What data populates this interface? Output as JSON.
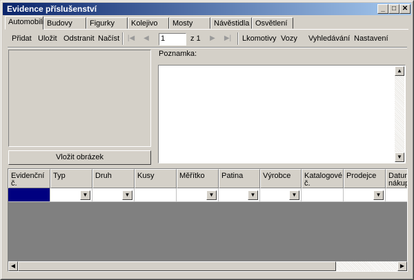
{
  "window": {
    "title": "Evidence příslušenství"
  },
  "tabs": [
    "Automobili",
    "Budovy",
    "Figurky",
    "Kolejivo",
    "Mosty",
    "Návěstidla",
    "Osvětlení"
  ],
  "toolbar": {
    "add": "Přidat",
    "save": "Uložit",
    "remove": "Odstranit",
    "load": "Načíst",
    "page_value": "1",
    "page_of": "z 1",
    "locomotives": "Lkomotivy",
    "wagons": "Vozy",
    "search": "Vyhledávání",
    "settings": "Nastavení"
  },
  "image_button": "Vložit obrázek",
  "note_label": "Poznamka:",
  "note_value": "",
  "grid": {
    "columns": [
      {
        "label": "Evidenční č.",
        "has_dropdown": false
      },
      {
        "label": "Typ",
        "has_dropdown": true
      },
      {
        "label": "Druh",
        "has_dropdown": true
      },
      {
        "label": "Kusy",
        "has_dropdown": false
      },
      {
        "label": "Měřítko",
        "has_dropdown": true
      },
      {
        "label": "Patina",
        "has_dropdown": true
      },
      {
        "label": "Výrobce",
        "has_dropdown": true
      },
      {
        "label": "Katalogové č.",
        "has_dropdown": false
      },
      {
        "label": "Prodejce",
        "has_dropdown": true
      },
      {
        "label": "Datum nákupu",
        "has_dropdown": false
      }
    ]
  },
  "colors": {
    "title_start": "#0a246a",
    "title_end": "#a6caf0",
    "selection": "#000080",
    "face": "#d4d0c8"
  }
}
